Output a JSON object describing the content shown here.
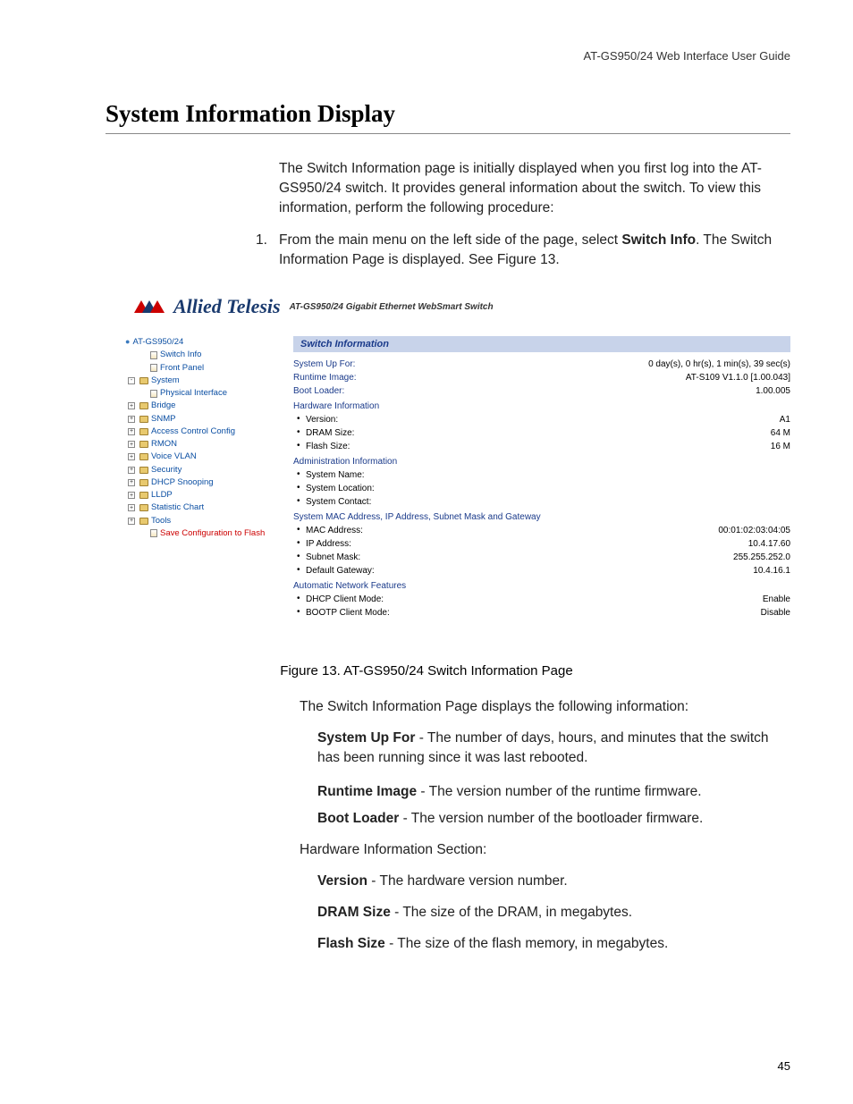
{
  "header": "AT-GS950/24  Web Interface User Guide",
  "title": "System Information Display",
  "intro": "The Switch Information page is initially displayed when you first log into the AT-GS950/24 switch. It provides general information about the switch. To view this information, perform the following procedure:",
  "step_num": "1.",
  "step_pre": "From the main menu on the left side of the page, select ",
  "step_bold": "Switch Info",
  "step_post": ". The Switch Information Page is displayed. See Figure 13.",
  "brand": "Allied Telesis",
  "brand_sub": "AT-GS950/24 Gigabit Ethernet WebSmart Switch",
  "nav": {
    "root": "AT-GS950/24",
    "items": [
      {
        "label": "Switch Info",
        "type": "page",
        "indent": 2
      },
      {
        "label": "Front Panel",
        "type": "page",
        "indent": 2
      },
      {
        "label": "System",
        "type": "folder",
        "exp": "-",
        "indent": 1
      },
      {
        "label": "Physical Interface",
        "type": "page",
        "indent": 2
      },
      {
        "label": "Bridge",
        "type": "folder",
        "exp": "+",
        "indent": 1
      },
      {
        "label": "SNMP",
        "type": "folder",
        "exp": "+",
        "indent": 1
      },
      {
        "label": "Access Control Config",
        "type": "folder",
        "exp": "+",
        "indent": 1
      },
      {
        "label": "RMON",
        "type": "folder",
        "exp": "+",
        "indent": 1
      },
      {
        "label": "Voice VLAN",
        "type": "folder",
        "exp": "+",
        "indent": 1
      },
      {
        "label": "Security",
        "type": "folder",
        "exp": "+",
        "indent": 1
      },
      {
        "label": "DHCP Snooping",
        "type": "folder",
        "exp": "+",
        "indent": 1
      },
      {
        "label": "LLDP",
        "type": "folder",
        "exp": "+",
        "indent": 1
      },
      {
        "label": "Statistic Chart",
        "type": "folder",
        "exp": "+",
        "indent": 1
      },
      {
        "label": "Tools",
        "type": "folder",
        "exp": "+",
        "indent": 1
      },
      {
        "label": "Save Configuration to Flash",
        "type": "page",
        "indent": 2,
        "red": true
      }
    ]
  },
  "panel": {
    "title": "Switch Information",
    "top": [
      {
        "label": "System Up For:",
        "value": "0 day(s), 0 hr(s), 1 min(s), 39 sec(s)"
      },
      {
        "label": "Runtime Image:",
        "value": "AT-S109 V1.1.0 [1.00.043]"
      },
      {
        "label": "Boot Loader:",
        "value": "1.00.005"
      }
    ],
    "hw_section": "Hardware Information",
    "hw": [
      {
        "label": "Version:",
        "value": "A1"
      },
      {
        "label": "DRAM Size:",
        "value": "64 M"
      },
      {
        "label": "Flash Size:",
        "value": "16 M"
      }
    ],
    "admin_section": "Administration Information",
    "admin": [
      {
        "label": "System Name:",
        "value": ""
      },
      {
        "label": "System Location:",
        "value": ""
      },
      {
        "label": "System Contact:",
        "value": ""
      }
    ],
    "net_section": "System MAC Address, IP Address, Subnet Mask and Gateway",
    "net": [
      {
        "label": "MAC Address:",
        "value": "00:01:02:03:04:05"
      },
      {
        "label": "IP Address:",
        "value": "10.4.17.60"
      },
      {
        "label": "Subnet Mask:",
        "value": "255.255.252.0"
      },
      {
        "label": "Default Gateway:",
        "value": "10.4.16.1"
      }
    ],
    "auto_section": "Automatic Network Features",
    "auto": [
      {
        "label": "DHCP Client Mode:",
        "value": "Enable"
      },
      {
        "label": "BOOTP Client Mode:",
        "value": "Disable"
      }
    ]
  },
  "caption": "Figure 13. AT-GS950/24 Switch Information Page",
  "para2": "The Switch Information Page displays the following information:",
  "defs": [
    {
      "term": "System Up For",
      "desc": " - The number of days, hours, and minutes that the switch has been running since it was last rebooted."
    },
    {
      "term": "Runtime Image",
      "desc": " - The version number of the runtime firmware."
    },
    {
      "term": "Boot Loader",
      "desc": " - The version number of the bootloader firmware."
    }
  ],
  "hw_heading": "Hardware Information Section:",
  "hw_defs": [
    {
      "term": "Version",
      "desc": " - The hardware version number."
    },
    {
      "term": "DRAM Size",
      "desc": " - The size of the DRAM, in megabytes."
    },
    {
      "term": "Flash Size",
      "desc": " - The size of the flash memory, in megabytes."
    }
  ],
  "page_num": "45"
}
